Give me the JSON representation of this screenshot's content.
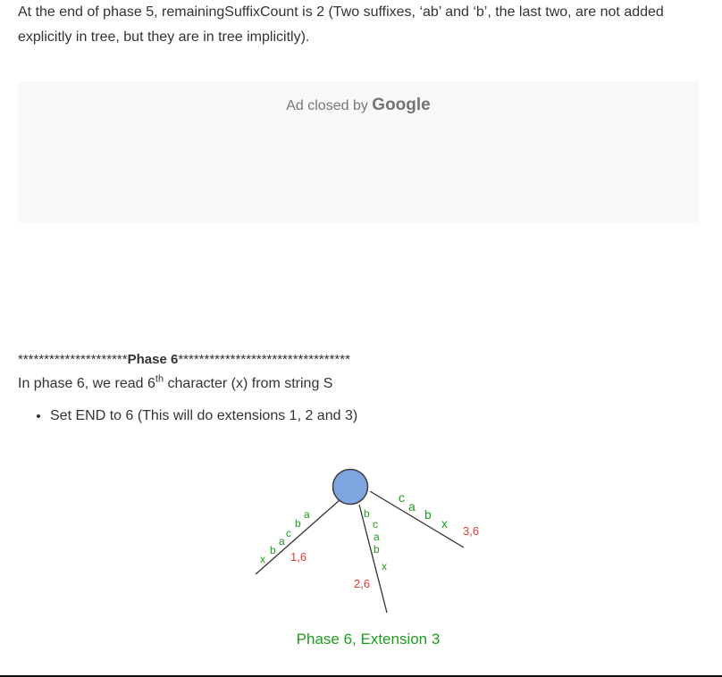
{
  "intro": {
    "line1": "At the end of phase 5, remainingSuffixCount is 2 (Two suffixes, ‘ab’ and ‘b’, the last two, are not added",
    "line2": "explicitly in tree, but they are in tree implicitly)."
  },
  "ad": {
    "prefix": "Ad closed by",
    "brand": "Google"
  },
  "phase": {
    "stars_left": "*********************",
    "title": "Phase 6",
    "stars_right": "*********************************"
  },
  "read": {
    "before": "In phase 6, we read 6",
    "sup": "th",
    "after": " character (x) from string S"
  },
  "bullets": [
    "Set END to 6 (This will do extensions 1, 2 and 3)"
  ],
  "figure": {
    "caption": "Phase 6, Extension 3",
    "edge1_chars": [
      "x",
      "b",
      "a",
      "c",
      "b",
      "a"
    ],
    "edge1_label": "1,6",
    "edge2_chars": [
      "b",
      "c",
      "a",
      "b",
      "x"
    ],
    "edge2_label": "2,6",
    "edge3_chars": [
      "c",
      "a",
      "b",
      "x"
    ],
    "edge3_label": "3,6",
    "colors": {
      "node_fill": "#7fa6e0",
      "node_stroke": "#3c3c3c",
      "edge_chars": "#1f9a1f",
      "edge_labels": "#e53935",
      "caption": "#1f9a1f",
      "lines": "#333333"
    }
  }
}
